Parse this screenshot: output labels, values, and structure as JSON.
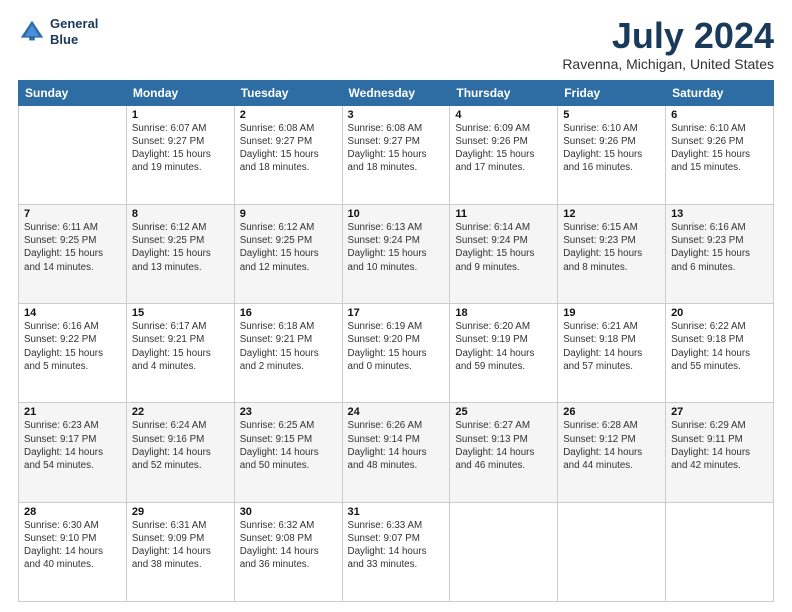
{
  "logo": {
    "line1": "General",
    "line2": "Blue"
  },
  "title": "July 2024",
  "subtitle": "Ravenna, Michigan, United States",
  "days_of_week": [
    "Sunday",
    "Monday",
    "Tuesday",
    "Wednesday",
    "Thursday",
    "Friday",
    "Saturday"
  ],
  "weeks": [
    [
      {
        "num": "",
        "info": ""
      },
      {
        "num": "1",
        "info": "Sunrise: 6:07 AM\nSunset: 9:27 PM\nDaylight: 15 hours\nand 19 minutes."
      },
      {
        "num": "2",
        "info": "Sunrise: 6:08 AM\nSunset: 9:27 PM\nDaylight: 15 hours\nand 18 minutes."
      },
      {
        "num": "3",
        "info": "Sunrise: 6:08 AM\nSunset: 9:27 PM\nDaylight: 15 hours\nand 18 minutes."
      },
      {
        "num": "4",
        "info": "Sunrise: 6:09 AM\nSunset: 9:26 PM\nDaylight: 15 hours\nand 17 minutes."
      },
      {
        "num": "5",
        "info": "Sunrise: 6:10 AM\nSunset: 9:26 PM\nDaylight: 15 hours\nand 16 minutes."
      },
      {
        "num": "6",
        "info": "Sunrise: 6:10 AM\nSunset: 9:26 PM\nDaylight: 15 hours\nand 15 minutes."
      }
    ],
    [
      {
        "num": "7",
        "info": "Sunrise: 6:11 AM\nSunset: 9:25 PM\nDaylight: 15 hours\nand 14 minutes."
      },
      {
        "num": "8",
        "info": "Sunrise: 6:12 AM\nSunset: 9:25 PM\nDaylight: 15 hours\nand 13 minutes."
      },
      {
        "num": "9",
        "info": "Sunrise: 6:12 AM\nSunset: 9:25 PM\nDaylight: 15 hours\nand 12 minutes."
      },
      {
        "num": "10",
        "info": "Sunrise: 6:13 AM\nSunset: 9:24 PM\nDaylight: 15 hours\nand 10 minutes."
      },
      {
        "num": "11",
        "info": "Sunrise: 6:14 AM\nSunset: 9:24 PM\nDaylight: 15 hours\nand 9 minutes."
      },
      {
        "num": "12",
        "info": "Sunrise: 6:15 AM\nSunset: 9:23 PM\nDaylight: 15 hours\nand 8 minutes."
      },
      {
        "num": "13",
        "info": "Sunrise: 6:16 AM\nSunset: 9:23 PM\nDaylight: 15 hours\nand 6 minutes."
      }
    ],
    [
      {
        "num": "14",
        "info": "Sunrise: 6:16 AM\nSunset: 9:22 PM\nDaylight: 15 hours\nand 5 minutes."
      },
      {
        "num": "15",
        "info": "Sunrise: 6:17 AM\nSunset: 9:21 PM\nDaylight: 15 hours\nand 4 minutes."
      },
      {
        "num": "16",
        "info": "Sunrise: 6:18 AM\nSunset: 9:21 PM\nDaylight: 15 hours\nand 2 minutes."
      },
      {
        "num": "17",
        "info": "Sunrise: 6:19 AM\nSunset: 9:20 PM\nDaylight: 15 hours\nand 0 minutes."
      },
      {
        "num": "18",
        "info": "Sunrise: 6:20 AM\nSunset: 9:19 PM\nDaylight: 14 hours\nand 59 minutes."
      },
      {
        "num": "19",
        "info": "Sunrise: 6:21 AM\nSunset: 9:18 PM\nDaylight: 14 hours\nand 57 minutes."
      },
      {
        "num": "20",
        "info": "Sunrise: 6:22 AM\nSunset: 9:18 PM\nDaylight: 14 hours\nand 55 minutes."
      }
    ],
    [
      {
        "num": "21",
        "info": "Sunrise: 6:23 AM\nSunset: 9:17 PM\nDaylight: 14 hours\nand 54 minutes."
      },
      {
        "num": "22",
        "info": "Sunrise: 6:24 AM\nSunset: 9:16 PM\nDaylight: 14 hours\nand 52 minutes."
      },
      {
        "num": "23",
        "info": "Sunrise: 6:25 AM\nSunset: 9:15 PM\nDaylight: 14 hours\nand 50 minutes."
      },
      {
        "num": "24",
        "info": "Sunrise: 6:26 AM\nSunset: 9:14 PM\nDaylight: 14 hours\nand 48 minutes."
      },
      {
        "num": "25",
        "info": "Sunrise: 6:27 AM\nSunset: 9:13 PM\nDaylight: 14 hours\nand 46 minutes."
      },
      {
        "num": "26",
        "info": "Sunrise: 6:28 AM\nSunset: 9:12 PM\nDaylight: 14 hours\nand 44 minutes."
      },
      {
        "num": "27",
        "info": "Sunrise: 6:29 AM\nSunset: 9:11 PM\nDaylight: 14 hours\nand 42 minutes."
      }
    ],
    [
      {
        "num": "28",
        "info": "Sunrise: 6:30 AM\nSunset: 9:10 PM\nDaylight: 14 hours\nand 40 minutes."
      },
      {
        "num": "29",
        "info": "Sunrise: 6:31 AM\nSunset: 9:09 PM\nDaylight: 14 hours\nand 38 minutes."
      },
      {
        "num": "30",
        "info": "Sunrise: 6:32 AM\nSunset: 9:08 PM\nDaylight: 14 hours\nand 36 minutes."
      },
      {
        "num": "31",
        "info": "Sunrise: 6:33 AM\nSunset: 9:07 PM\nDaylight: 14 hours\nand 33 minutes."
      },
      {
        "num": "",
        "info": ""
      },
      {
        "num": "",
        "info": ""
      },
      {
        "num": "",
        "info": ""
      }
    ]
  ]
}
